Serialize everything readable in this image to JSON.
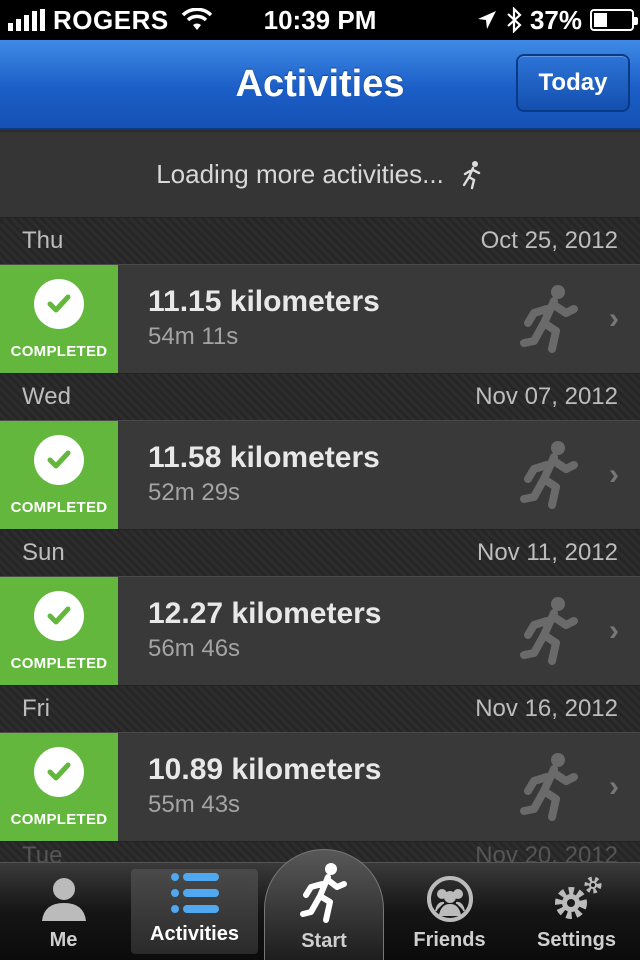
{
  "status": {
    "carrier": "ROGERS",
    "time": "10:39 PM",
    "battery_text": "37%",
    "battery_level": 0.37,
    "icons": [
      "signal-icon",
      "wifi-icon",
      "location-icon",
      "bluetooth-icon",
      "battery-icon"
    ]
  },
  "nav": {
    "title": "Activities",
    "today_label": "Today",
    "accent": "#1b5ec7"
  },
  "loading_text": "Loading more activities...",
  "activities": [
    {
      "day": "Thu",
      "date": "Oct 25, 2012",
      "status": "COMPLETED",
      "distance": "11.15 kilometers",
      "duration": "54m 11s"
    },
    {
      "day": "Wed",
      "date": "Nov 07, 2012",
      "status": "COMPLETED",
      "distance": "11.58 kilometers",
      "duration": "52m 29s"
    },
    {
      "day": "Sun",
      "date": "Nov 11, 2012",
      "status": "COMPLETED",
      "distance": "12.27 kilometers",
      "duration": "56m 46s"
    },
    {
      "day": "Fri",
      "date": "Nov 16, 2012",
      "status": "COMPLETED",
      "distance": "10.89 kilometers",
      "duration": "55m 43s"
    }
  ],
  "peek_row": {
    "day": "Tue",
    "date": "Nov 20, 2012"
  },
  "status_color": "#62b73c",
  "tabs": {
    "me": "Me",
    "activities": "Activities",
    "start": "Start",
    "friends": "Friends",
    "settings": "Settings"
  }
}
